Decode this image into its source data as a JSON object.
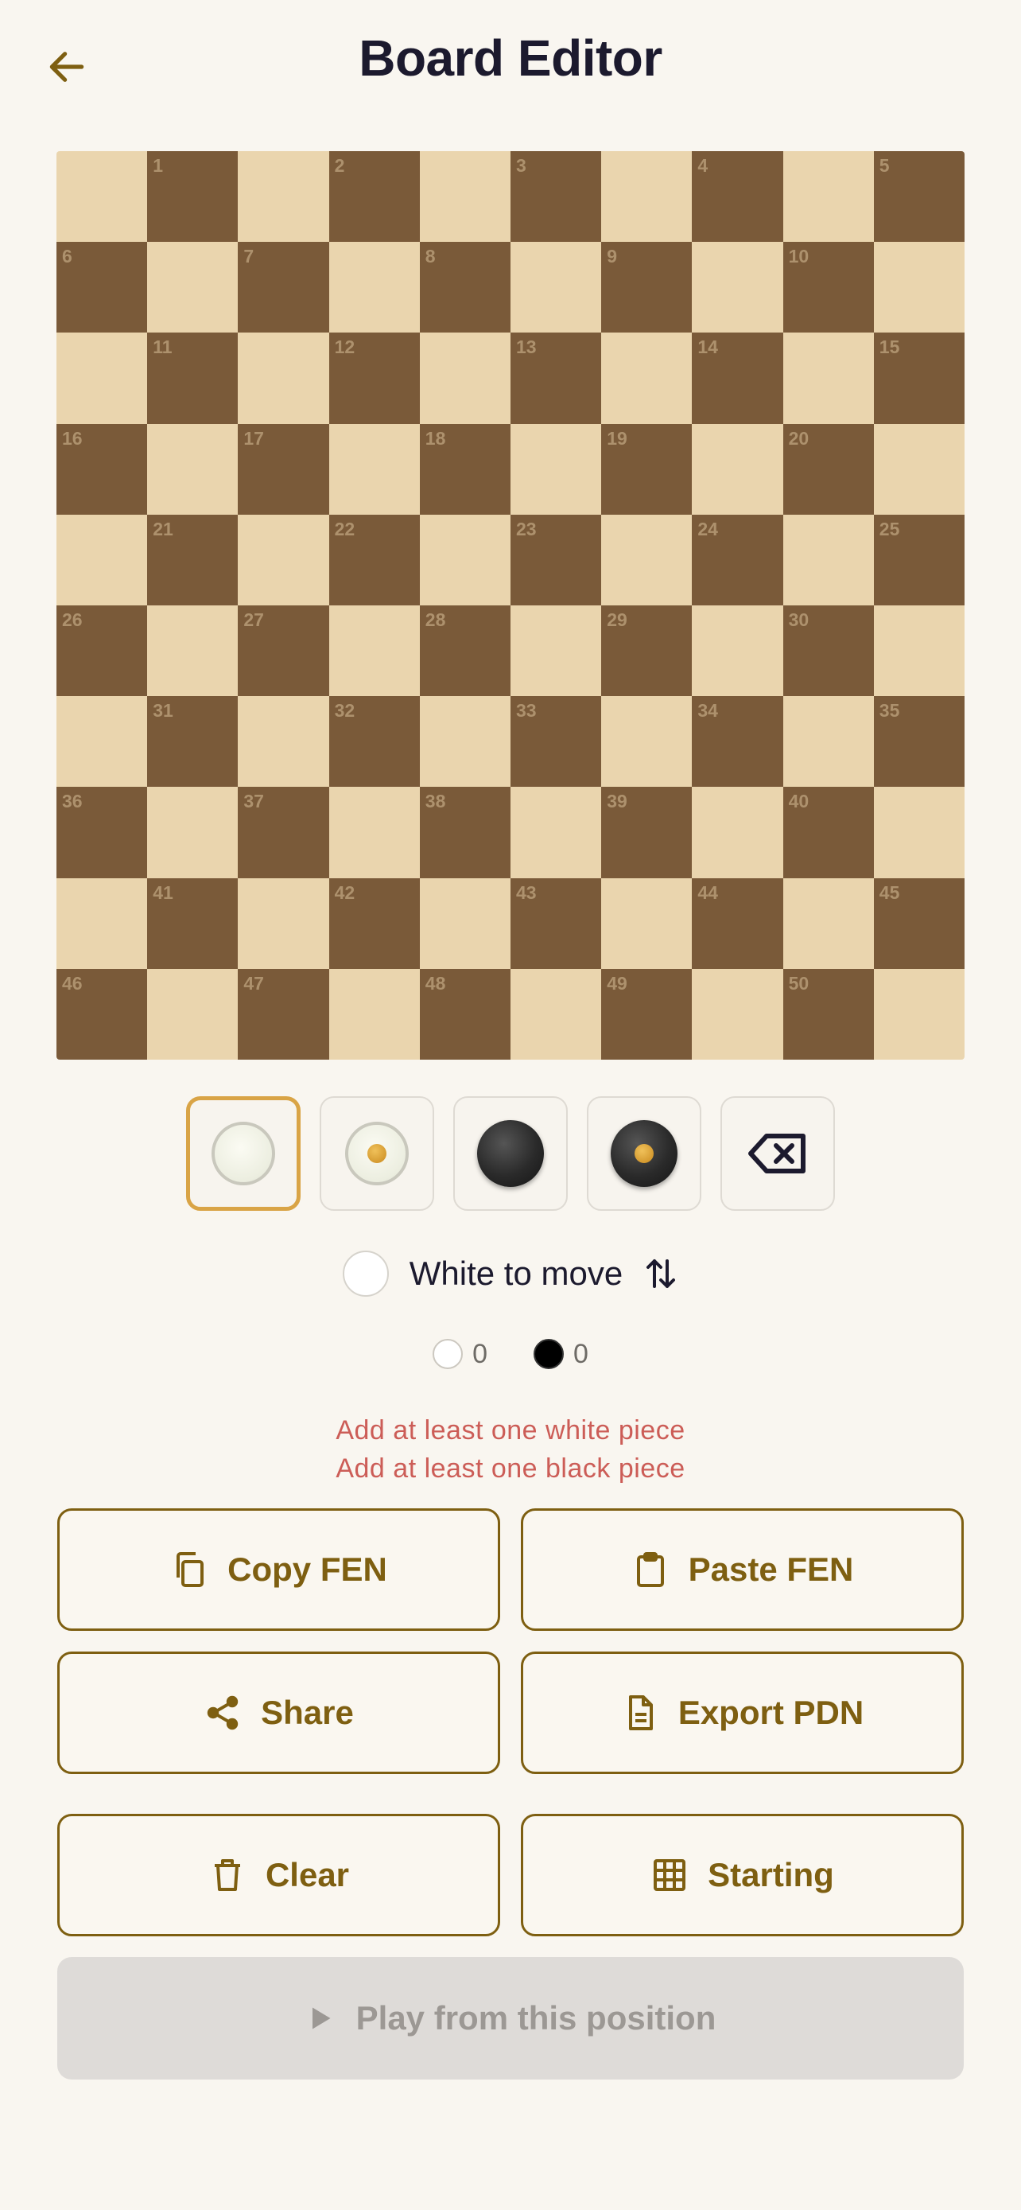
{
  "header": {
    "title": "Board Editor",
    "back_icon": "arrow-left-icon"
  },
  "board": {
    "size": 10,
    "light_color": "#ead5ae",
    "dark_color": "#7a5a39",
    "square_numbers": [
      1,
      2,
      3,
      4,
      5,
      6,
      7,
      8,
      9,
      10,
      11,
      12,
      13,
      14,
      15,
      16,
      17,
      18,
      19,
      20,
      21,
      22,
      23,
      24,
      25,
      26,
      27,
      28,
      29,
      30,
      31,
      32,
      33,
      34,
      35,
      36,
      37,
      38,
      39,
      40,
      41,
      42,
      43,
      44,
      45,
      46,
      47,
      48,
      49,
      50
    ]
  },
  "palette": {
    "items": [
      {
        "name": "white-man",
        "icon": "white-piece-icon",
        "selected": true
      },
      {
        "name": "white-king",
        "icon": "white-king-icon",
        "selected": false
      },
      {
        "name": "black-man",
        "icon": "black-piece-icon",
        "selected": false
      },
      {
        "name": "black-king",
        "icon": "black-king-icon",
        "selected": false
      },
      {
        "name": "eraser",
        "icon": "backspace-icon",
        "selected": false
      }
    ],
    "accent": "#d9a446"
  },
  "turn": {
    "label": "White to move",
    "swap_icon": "swap-vertical-icon"
  },
  "counts": {
    "white": "0",
    "black": "0"
  },
  "errors": {
    "white": "Add at least one white piece",
    "black": "Add at least one black piece"
  },
  "actions": {
    "copy_fen": "Copy FEN",
    "paste_fen": "Paste FEN",
    "share": "Share",
    "export_pdn": "Export PDN",
    "clear": "Clear",
    "starting": "Starting",
    "play": "Play from this position"
  },
  "colors": {
    "primary": "#7e5f11",
    "error": "#cc5d57",
    "background": "#f9f6f0",
    "disabled_bg": "#dedbd8"
  }
}
